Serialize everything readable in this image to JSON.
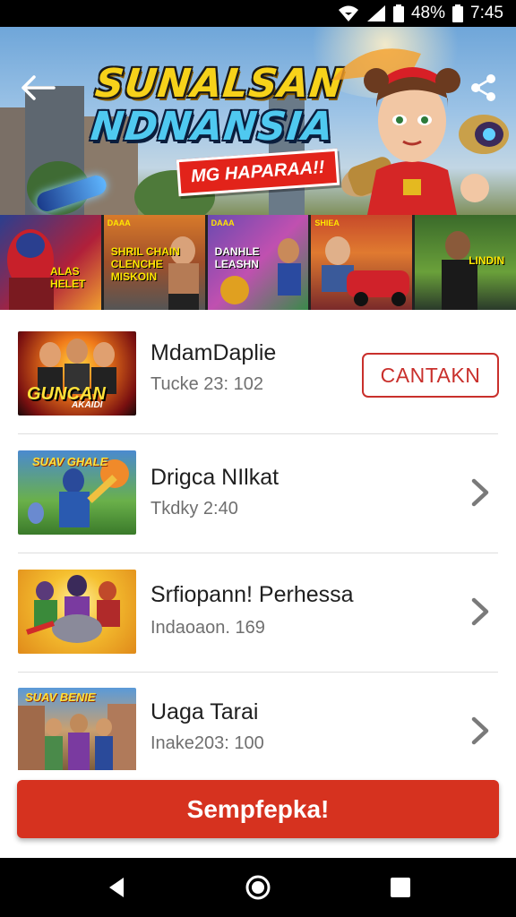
{
  "status_bar": {
    "battery": "48%",
    "time": "7:45"
  },
  "hero": {
    "title_line1": "SUNALSAN",
    "title_line2": "NDNANSIA",
    "subtitle": "MG HAPARAA!!"
  },
  "thumbnails": [
    {
      "label": "ALAS HELET",
      "badge": ""
    },
    {
      "label": "SHRIL CHAIN CLENCHE MISKOIN",
      "badge": "DAAA"
    },
    {
      "label": "DANHLE LEASHN",
      "badge": "DAAA"
    },
    {
      "label": "",
      "badge": "SHIEA"
    },
    {
      "label": "LINDIN",
      "badge": ""
    }
  ],
  "items": [
    {
      "title": "MdamDaplie",
      "subtitle": "Tucke 23: 102",
      "thumb_text": "GUNCAN",
      "thumb_text2": "AKAIDI",
      "action": "CANTAKN"
    },
    {
      "title": "Drigca NIlkat",
      "subtitle": "Tkdky 2:40",
      "thumb_text": "SUAV GHALE",
      "thumb_text2": ""
    },
    {
      "title": "Srfiopann! Perhessa",
      "subtitle": "Indaoaon. 169",
      "thumb_text": "",
      "thumb_text2": ""
    },
    {
      "title": "Uaga Tarai",
      "subtitle": "Inake203: 100",
      "thumb_text": "SUAV BENIE",
      "thumb_text2": ""
    }
  ],
  "cta_label": "Sempfepka!",
  "colors": {
    "accent": "#d6321f",
    "outline_red": "#c9302c"
  },
  "icons": [
    "wifi-icon",
    "signal-icon",
    "battery-icon",
    "back-arrow-icon",
    "share-icon",
    "chevron-right-icon",
    "nav-back-icon",
    "nav-home-icon",
    "nav-recents-icon"
  ]
}
